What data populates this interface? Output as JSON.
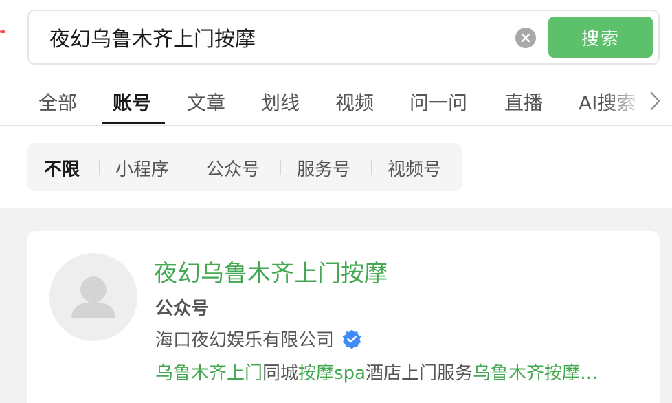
{
  "search": {
    "query": "夜幻乌鲁木齐上门按摩",
    "button_label": "搜索"
  },
  "tabs": [
    {
      "label": "全部",
      "active": false
    },
    {
      "label": "账号",
      "active": true
    },
    {
      "label": "文章",
      "active": false
    },
    {
      "label": "划线",
      "active": false
    },
    {
      "label": "视频",
      "active": false
    },
    {
      "label": "问一问",
      "active": false
    },
    {
      "label": "直播",
      "active": false
    },
    {
      "label": "AI搜索",
      "active": false
    }
  ],
  "filters": [
    {
      "label": "不限",
      "active": true
    },
    {
      "label": "小程序",
      "active": false
    },
    {
      "label": "公众号",
      "active": false
    },
    {
      "label": "服务号",
      "active": false
    },
    {
      "label": "视频号",
      "active": false
    }
  ],
  "result": {
    "name": "夜幻乌鲁木齐上门按摩",
    "type": "公众号",
    "company": "海口夜幻娱乐有限公司",
    "verified_icon": "verified-badge-icon",
    "description": {
      "seg1": "乌鲁木齐上门",
      "seg2": "同城",
      "seg3": "按摩spa",
      "seg4": "酒店上门服务",
      "seg5": "乌鲁木齐按摩…"
    }
  },
  "colors": {
    "accent_green": "#5dc06b",
    "link_green": "#43a851",
    "verified_blue": "#3f8cf7"
  }
}
